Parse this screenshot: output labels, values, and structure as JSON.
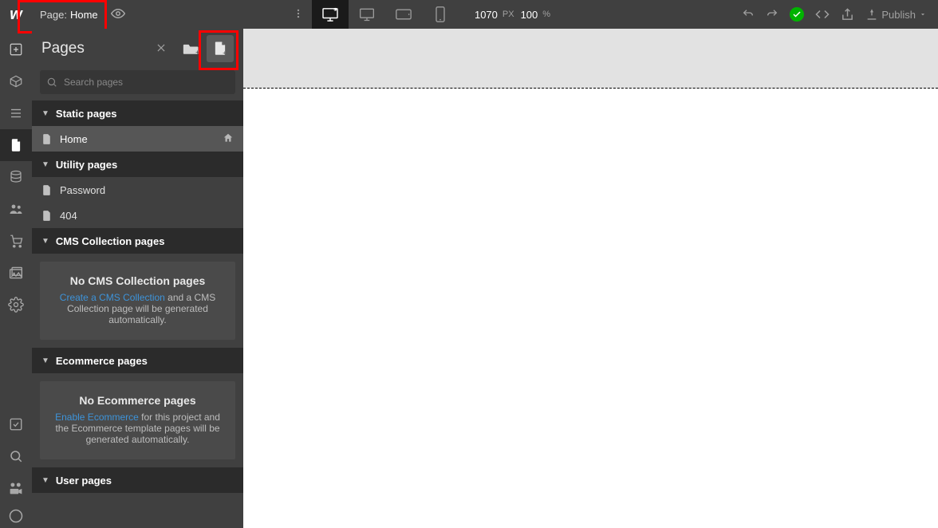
{
  "topbar": {
    "page_label": "Page:",
    "page_name": "Home",
    "viewport_width": "1070",
    "viewport_unit": "PX",
    "zoom_value": "100",
    "zoom_unit": "%",
    "publish_label": "Publish"
  },
  "panel": {
    "title": "Pages",
    "search_placeholder": "Search pages",
    "sections": {
      "static": {
        "label": "Static pages"
      },
      "utility": {
        "label": "Utility pages"
      },
      "cms": {
        "label": "CMS Collection pages"
      },
      "ecom": {
        "label": "Ecommerce pages"
      },
      "user": {
        "label": "User pages"
      }
    },
    "pages": {
      "home": "Home",
      "password": "Password",
      "p404": "404"
    },
    "empty_cms": {
      "title": "No CMS Collection pages",
      "link": "Create a CMS Collection",
      "rest": " and a CMS Collection page will be generated automatically."
    },
    "empty_ecom": {
      "title": "No Ecommerce pages",
      "link": "Enable Ecommerce",
      "rest": " for this project and the Ecommerce template pages will be generated automatically."
    }
  }
}
